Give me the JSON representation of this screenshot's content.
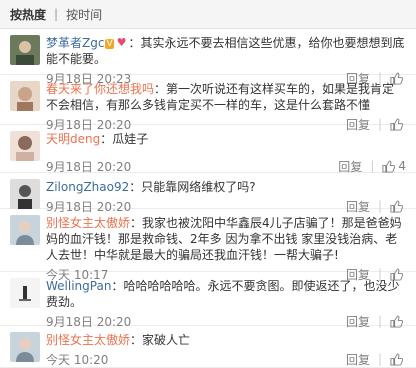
{
  "sortbar": {
    "hot_label": "按热度",
    "sep": "|",
    "time_label": "按时间"
  },
  "actions": {
    "reply": "回复",
    "divider": "|"
  },
  "comments": [
    {
      "user": "梦革者Zgc",
      "text": "：其实永远不要去相信这些优惠，给你也要想想到底能不能要。",
      "time": "9月18日 20:23",
      "likes": "",
      "avatar_color": "#6b7a5a"
    },
    {
      "user": "春天来了你还想我吗",
      "text": "：第一次听说还有这样买车的，如果是我肯定不会相信，有那么多钱肯定买不一样的车，这是什么套路不懂",
      "time": "9月18日 20:20",
      "likes": "",
      "avatar_color": "#c9a48a"
    },
    {
      "user": "天明deng",
      "text": "：瓜娃子",
      "time": "9月18日 20:20",
      "likes": "4",
      "avatar_color": "#8a6a5a"
    },
    {
      "user": "ZilongZhao92",
      "text": "：只能靠网络维权了吗?",
      "time": "9月18日 20:20",
      "likes": "",
      "avatar_color": "#555555"
    },
    {
      "user": "别怪女主太傲娇",
      "text": "：我家也被沈阳中华鑫辰4儿子店骗了！那是爸爸妈妈的血汗钱！那是救命钱、2年多 因为拿不出钱 家里没钱治病、老人去世！中华就是最大的骗局还我血汗钱！一帮大骗子!",
      "time": "今天 10:17",
      "likes": "",
      "avatar_color": "#7a8c9a"
    },
    {
      "user": "WellingPan",
      "text": "：哈哈哈哈哈哈。永远不要贪图。即使返还了，也没少费劲。",
      "time": "9月18日 20:20",
      "likes": "",
      "avatar_color": "#b8b8b8"
    },
    {
      "user": "别怪女主太傲娇",
      "text": "：家破人亡",
      "time": "今天 10:20",
      "likes": "",
      "avatar_color": "#7a8c9a"
    }
  ],
  "colors": {
    "username": "#eb7350",
    "username_alt": "#3e6b9e",
    "meta": "#808080",
    "text": "#333333"
  },
  "icons": [
    "thumb-up-icon",
    "vip-v-icon",
    "heart-icon"
  ]
}
